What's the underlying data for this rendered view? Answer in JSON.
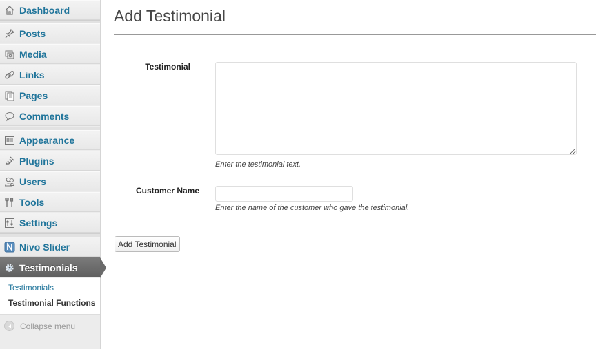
{
  "sidebar": {
    "items": [
      {
        "id": "dashboard",
        "label": "Dashboard",
        "icon": "home-icon"
      },
      {
        "id": "posts",
        "label": "Posts",
        "icon": "pushpin-icon"
      },
      {
        "id": "media",
        "label": "Media",
        "icon": "media-icon"
      },
      {
        "id": "links",
        "label": "Links",
        "icon": "chain-link-icon"
      },
      {
        "id": "pages",
        "label": "Pages",
        "icon": "pages-icon"
      },
      {
        "id": "comments",
        "label": "Comments",
        "icon": "speech-bubble-icon"
      },
      {
        "id": "appearance",
        "label": "Appearance",
        "icon": "appearance-icon"
      },
      {
        "id": "plugins",
        "label": "Plugins",
        "icon": "plug-icon"
      },
      {
        "id": "users",
        "label": "Users",
        "icon": "users-icon"
      },
      {
        "id": "tools",
        "label": "Tools",
        "icon": "tools-icon"
      },
      {
        "id": "settings",
        "label": "Settings",
        "icon": "settings-icon"
      },
      {
        "id": "nivo-slider",
        "label": "Nivo Slider",
        "icon": "nivo-n-icon"
      },
      {
        "id": "testimonials",
        "label": "Testimonials",
        "icon": "gear-icon"
      }
    ],
    "active": "testimonials",
    "submenu": {
      "testimonials": "Testimonials",
      "testimonial_functions": "Testimonial Functions"
    },
    "collapse_label": "Collapse menu"
  },
  "page": {
    "title": "Add Testimonial"
  },
  "form": {
    "testimonial_label": "Testimonial",
    "testimonial_value": "",
    "testimonial_description": "Enter the testimonial text.",
    "customer_label": "Customer Name",
    "customer_value": "",
    "customer_description": "Enter the name of the customer who gave the testimonial.",
    "submit_label": "Add Testimonial"
  },
  "colors": {
    "link": "#21759b",
    "active_menu": "#6a6a6a"
  }
}
